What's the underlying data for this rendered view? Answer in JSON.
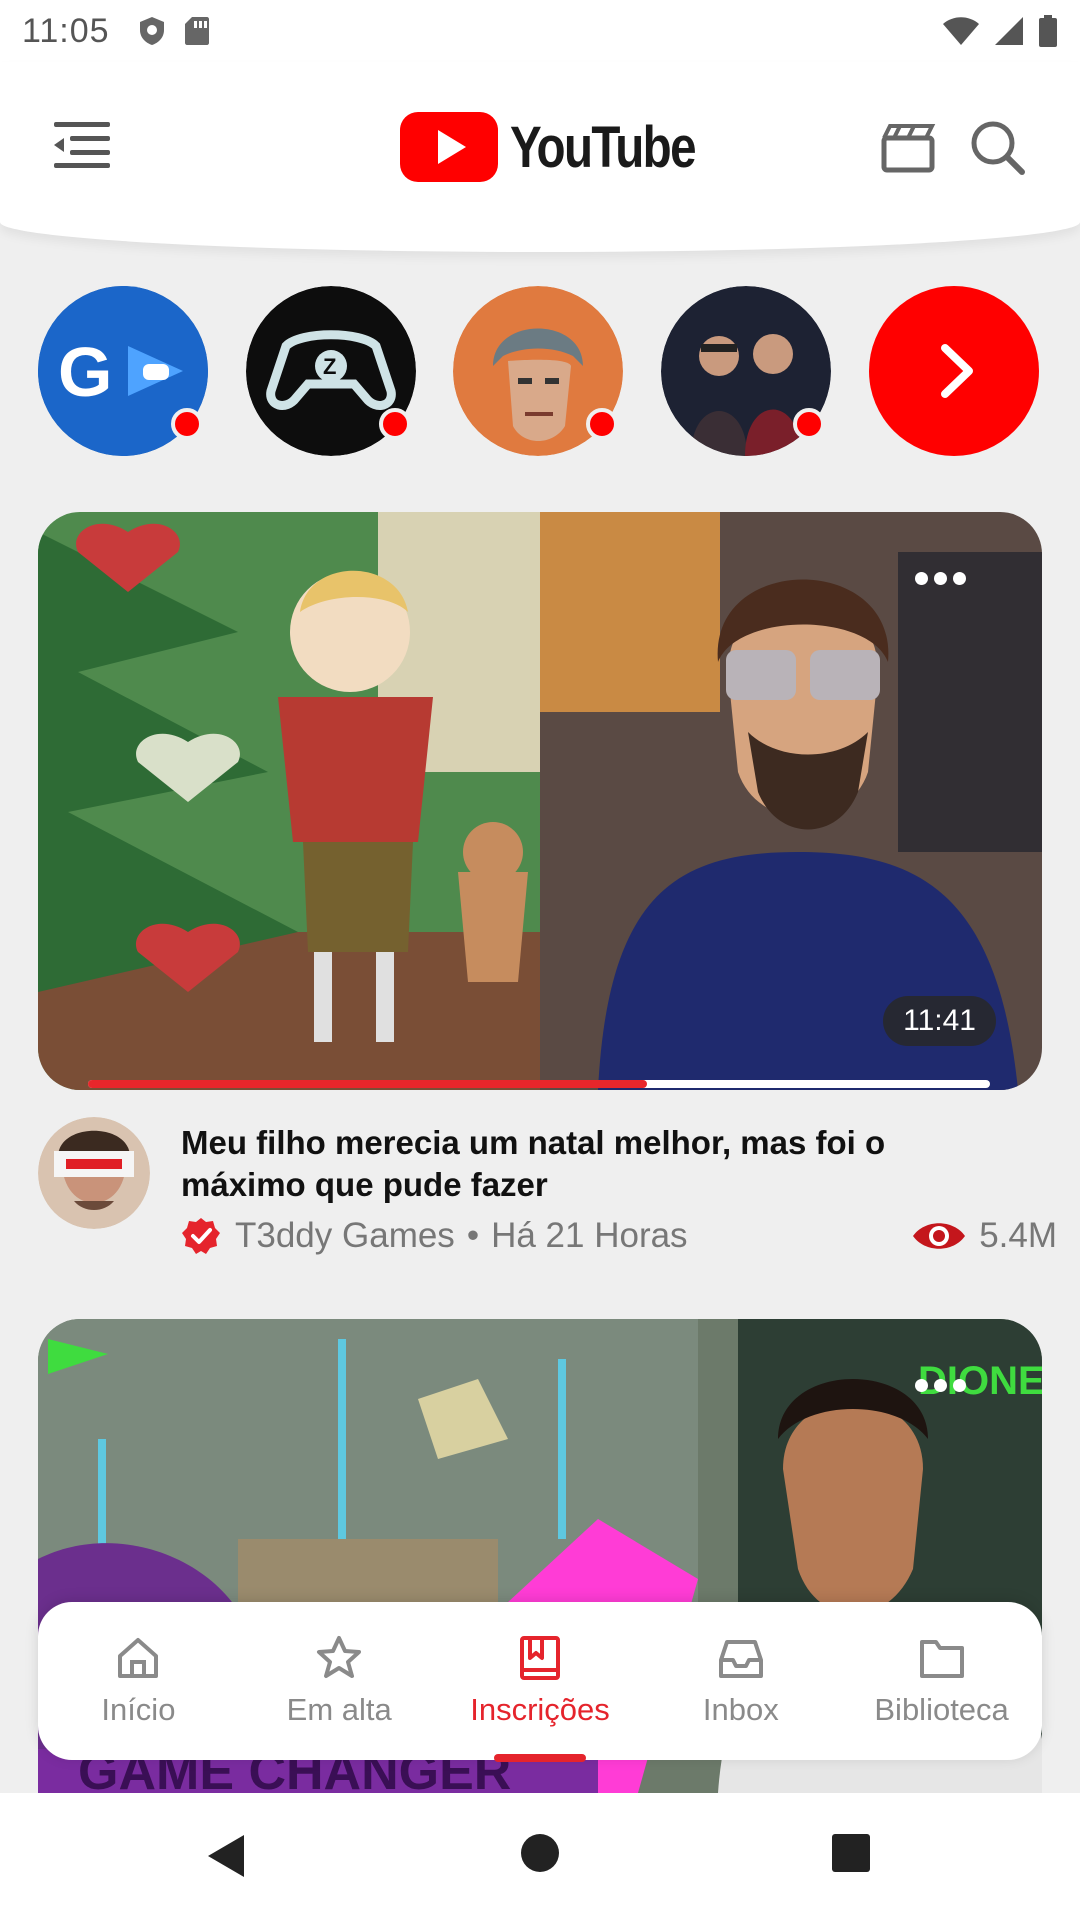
{
  "status_bar": {
    "time": "11:05",
    "left_icons": [
      "shield-icon",
      "sd-card-icon"
    ],
    "right_icons": [
      "wifi-icon",
      "signal-icon",
      "battery-icon"
    ]
  },
  "header": {
    "logo_text": "YouTube",
    "icons": [
      "menu-icon",
      "clapperboard-icon",
      "search-icon"
    ],
    "brand_color": "#ff0000"
  },
  "channels": [
    {
      "name": "channel-gamer-g",
      "live_dot": true
    },
    {
      "name": "channel-controller-z",
      "live_dot": true
    },
    {
      "name": "channel-cartoon-face",
      "live_dot": true
    },
    {
      "name": "channel-duo",
      "live_dot": true
    },
    {
      "name": "see-more",
      "icon": "chevron-right-icon"
    }
  ],
  "videos": [
    {
      "title": "Meu filho merecia um natal melhor, mas foi o máximo que pude fazer",
      "channel": "T3ddy Games",
      "separator": "•",
      "age": "Há 21 Horas",
      "views": "5.4M",
      "duration": "11:41",
      "watch_progress": 0.62,
      "verified": true
    },
    {
      "thumbnail_text": "DIONES",
      "bottom_text": "GAME CHANGER"
    }
  ],
  "bottom_nav": {
    "items": [
      {
        "label": "Início",
        "icon": "home-icon",
        "active": false
      },
      {
        "label": "Em alta",
        "icon": "star-icon",
        "active": false
      },
      {
        "label": "Inscrições",
        "icon": "subscriptions-icon",
        "active": true
      },
      {
        "label": "Inbox",
        "icon": "inbox-icon",
        "active": false
      },
      {
        "label": "Biblioteca",
        "icon": "folder-icon",
        "active": false
      }
    ],
    "active_color": "#e5242c"
  },
  "system_nav": [
    "back-icon",
    "home-circle-icon",
    "recents-icon"
  ]
}
